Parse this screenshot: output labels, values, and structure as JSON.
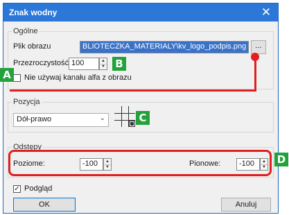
{
  "dialog": {
    "title": "Znak wodny",
    "close_label": "✕"
  },
  "general": {
    "legend": "Ogólne",
    "file_label": "Plik obrazu",
    "file_value": "BLIOTECZKA_MATERIALY\\kv_logo_podpis.png",
    "browse_label": "...",
    "transparency_label": "Przezroczystość:",
    "transparency_value": "100",
    "alpha_checkbox_label": "Nie używaj kanału alfa z obrazu",
    "alpha_checked": false
  },
  "position": {
    "legend": "Pozycja",
    "selected": "Dół-prawo"
  },
  "offsets": {
    "legend": "Odstępy",
    "horizontal_label": "Poziome:",
    "horizontal_value": "-100",
    "vertical_label": "Pionowe:",
    "vertical_value": "-100"
  },
  "preview": {
    "label": "Podgląd",
    "checked": true
  },
  "buttons": {
    "ok": "OK",
    "cancel": "Anuluj"
  },
  "badges": {
    "a": "A",
    "b": "B",
    "c": "C",
    "d": "D"
  },
  "colors": {
    "titlebar": "#2b78d8",
    "badge": "#23a23b",
    "callout": "#e02020",
    "selection": "#3a72c8"
  },
  "icons": {
    "spin_up": "▲",
    "spin_down": "▼",
    "dropdown": "⌄",
    "check": "✓"
  }
}
